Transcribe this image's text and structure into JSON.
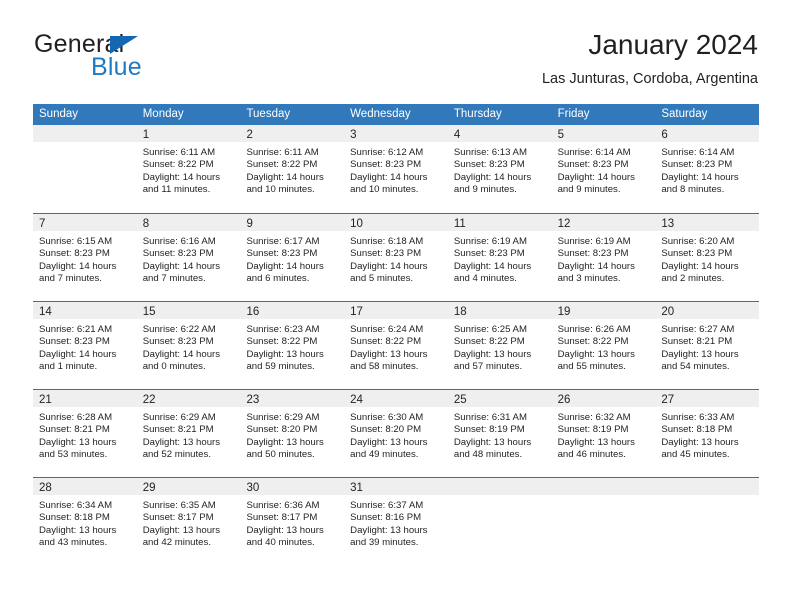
{
  "brand": {
    "name_top": "General",
    "name_bottom": "Blue",
    "accent_color": "#1f7ac4",
    "triangle_color": "#1567b2",
    "logo_icon": "triangle-icon"
  },
  "header": {
    "title": "January 2024",
    "subtitle": "Las Junturas, Cordoba, Argentina"
  },
  "calendar": {
    "header_bg": "#3179bb",
    "header_text_color": "#ffffff",
    "row_divider_color": "#2f73b5",
    "daynum_band_color": "#efefef",
    "weekdays": [
      "Sunday",
      "Monday",
      "Tuesday",
      "Wednesday",
      "Thursday",
      "Friday",
      "Saturday"
    ],
    "weeks": [
      [
        {
          "day": "",
          "lines": []
        },
        {
          "day": "1",
          "lines": [
            "Sunrise: 6:11 AM",
            "Sunset: 8:22 PM",
            "Daylight: 14 hours",
            "and 11 minutes."
          ]
        },
        {
          "day": "2",
          "lines": [
            "Sunrise: 6:11 AM",
            "Sunset: 8:22 PM",
            "Daylight: 14 hours",
            "and 10 minutes."
          ]
        },
        {
          "day": "3",
          "lines": [
            "Sunrise: 6:12 AM",
            "Sunset: 8:23 PM",
            "Daylight: 14 hours",
            "and 10 minutes."
          ]
        },
        {
          "day": "4",
          "lines": [
            "Sunrise: 6:13 AM",
            "Sunset: 8:23 PM",
            "Daylight: 14 hours",
            "and 9 minutes."
          ]
        },
        {
          "day": "5",
          "lines": [
            "Sunrise: 6:14 AM",
            "Sunset: 8:23 PM",
            "Daylight: 14 hours",
            "and 9 minutes."
          ]
        },
        {
          "day": "6",
          "lines": [
            "Sunrise: 6:14 AM",
            "Sunset: 8:23 PM",
            "Daylight: 14 hours",
            "and 8 minutes."
          ]
        }
      ],
      [
        {
          "day": "7",
          "lines": [
            "Sunrise: 6:15 AM",
            "Sunset: 8:23 PM",
            "Daylight: 14 hours",
            "and 7 minutes."
          ]
        },
        {
          "day": "8",
          "lines": [
            "Sunrise: 6:16 AM",
            "Sunset: 8:23 PM",
            "Daylight: 14 hours",
            "and 7 minutes."
          ]
        },
        {
          "day": "9",
          "lines": [
            "Sunrise: 6:17 AM",
            "Sunset: 8:23 PM",
            "Daylight: 14 hours",
            "and 6 minutes."
          ]
        },
        {
          "day": "10",
          "lines": [
            "Sunrise: 6:18 AM",
            "Sunset: 8:23 PM",
            "Daylight: 14 hours",
            "and 5 minutes."
          ]
        },
        {
          "day": "11",
          "lines": [
            "Sunrise: 6:19 AM",
            "Sunset: 8:23 PM",
            "Daylight: 14 hours",
            "and 4 minutes."
          ]
        },
        {
          "day": "12",
          "lines": [
            "Sunrise: 6:19 AM",
            "Sunset: 8:23 PM",
            "Daylight: 14 hours",
            "and 3 minutes."
          ]
        },
        {
          "day": "13",
          "lines": [
            "Sunrise: 6:20 AM",
            "Sunset: 8:23 PM",
            "Daylight: 14 hours",
            "and 2 minutes."
          ]
        }
      ],
      [
        {
          "day": "14",
          "lines": [
            "Sunrise: 6:21 AM",
            "Sunset: 8:23 PM",
            "Daylight: 14 hours",
            "and 1 minute."
          ]
        },
        {
          "day": "15",
          "lines": [
            "Sunrise: 6:22 AM",
            "Sunset: 8:23 PM",
            "Daylight: 14 hours",
            "and 0 minutes."
          ]
        },
        {
          "day": "16",
          "lines": [
            "Sunrise: 6:23 AM",
            "Sunset: 8:22 PM",
            "Daylight: 13 hours",
            "and 59 minutes."
          ]
        },
        {
          "day": "17",
          "lines": [
            "Sunrise: 6:24 AM",
            "Sunset: 8:22 PM",
            "Daylight: 13 hours",
            "and 58 minutes."
          ]
        },
        {
          "day": "18",
          "lines": [
            "Sunrise: 6:25 AM",
            "Sunset: 8:22 PM",
            "Daylight: 13 hours",
            "and 57 minutes."
          ]
        },
        {
          "day": "19",
          "lines": [
            "Sunrise: 6:26 AM",
            "Sunset: 8:22 PM",
            "Daylight: 13 hours",
            "and 55 minutes."
          ]
        },
        {
          "day": "20",
          "lines": [
            "Sunrise: 6:27 AM",
            "Sunset: 8:21 PM",
            "Daylight: 13 hours",
            "and 54 minutes."
          ]
        }
      ],
      [
        {
          "day": "21",
          "lines": [
            "Sunrise: 6:28 AM",
            "Sunset: 8:21 PM",
            "Daylight: 13 hours",
            "and 53 minutes."
          ]
        },
        {
          "day": "22",
          "lines": [
            "Sunrise: 6:29 AM",
            "Sunset: 8:21 PM",
            "Daylight: 13 hours",
            "and 52 minutes."
          ]
        },
        {
          "day": "23",
          "lines": [
            "Sunrise: 6:29 AM",
            "Sunset: 8:20 PM",
            "Daylight: 13 hours",
            "and 50 minutes."
          ]
        },
        {
          "day": "24",
          "lines": [
            "Sunrise: 6:30 AM",
            "Sunset: 8:20 PM",
            "Daylight: 13 hours",
            "and 49 minutes."
          ]
        },
        {
          "day": "25",
          "lines": [
            "Sunrise: 6:31 AM",
            "Sunset: 8:19 PM",
            "Daylight: 13 hours",
            "and 48 minutes."
          ]
        },
        {
          "day": "26",
          "lines": [
            "Sunrise: 6:32 AM",
            "Sunset: 8:19 PM",
            "Daylight: 13 hours",
            "and 46 minutes."
          ]
        },
        {
          "day": "27",
          "lines": [
            "Sunrise: 6:33 AM",
            "Sunset: 8:18 PM",
            "Daylight: 13 hours",
            "and 45 minutes."
          ]
        }
      ],
      [
        {
          "day": "28",
          "lines": [
            "Sunrise: 6:34 AM",
            "Sunset: 8:18 PM",
            "Daylight: 13 hours",
            "and 43 minutes."
          ]
        },
        {
          "day": "29",
          "lines": [
            "Sunrise: 6:35 AM",
            "Sunset: 8:17 PM",
            "Daylight: 13 hours",
            "and 42 minutes."
          ]
        },
        {
          "day": "30",
          "lines": [
            "Sunrise: 6:36 AM",
            "Sunset: 8:17 PM",
            "Daylight: 13 hours",
            "and 40 minutes."
          ]
        },
        {
          "day": "31",
          "lines": [
            "Sunrise: 6:37 AM",
            "Sunset: 8:16 PM",
            "Daylight: 13 hours",
            "and 39 minutes."
          ]
        },
        {
          "day": "",
          "lines": []
        },
        {
          "day": "",
          "lines": []
        },
        {
          "day": "",
          "lines": []
        }
      ]
    ]
  }
}
